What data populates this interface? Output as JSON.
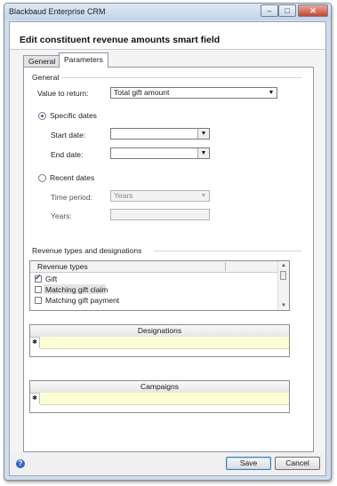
{
  "window": {
    "title": "Blackbaud Enterprise CRM",
    "min_glyph": "–",
    "max_glyph": "□",
    "close_glyph": "✕"
  },
  "dialog": {
    "heading": "Edit constituent revenue amounts smart field"
  },
  "tabs": [
    {
      "label": "General"
    },
    {
      "label": "Parameters",
      "active": true
    }
  ],
  "general": {
    "section_title": "General",
    "value_to_return": {
      "label": "Value to return:",
      "value": "Total gift amount"
    },
    "specific_dates": {
      "label": "Specific dates",
      "selected": true,
      "start_date": {
        "label": "Start date:",
        "value": ""
      },
      "end_date": {
        "label": "End date:",
        "value": ""
      }
    },
    "recent_dates": {
      "label": "Recent dates",
      "selected": false,
      "time_period": {
        "label": "Time period:",
        "value": "Years"
      },
      "years": {
        "label": "Years:",
        "value": ""
      }
    }
  },
  "revenue": {
    "section_title": "Revenue types and designations",
    "list_header": "Revenue types",
    "items": [
      {
        "label": "Gift",
        "checked": true
      },
      {
        "label": "Matching gift claim",
        "checked": false
      },
      {
        "label": "Matching gift payment",
        "checked": false
      }
    ],
    "designations_header": "Designations",
    "campaigns_header": "Campaigns",
    "new_row_glyph": "✱"
  },
  "buttons": {
    "help": "?",
    "save": "Save",
    "cancel": "Cancel"
  },
  "icons": {
    "dropdown": "▼",
    "scroll_up": "▲",
    "scroll_down": "▼"
  },
  "colors": {
    "new_row_bg": "#fdfdd4",
    "help_blue": "#2d69c9",
    "radio_dot": "#2a63b8"
  }
}
